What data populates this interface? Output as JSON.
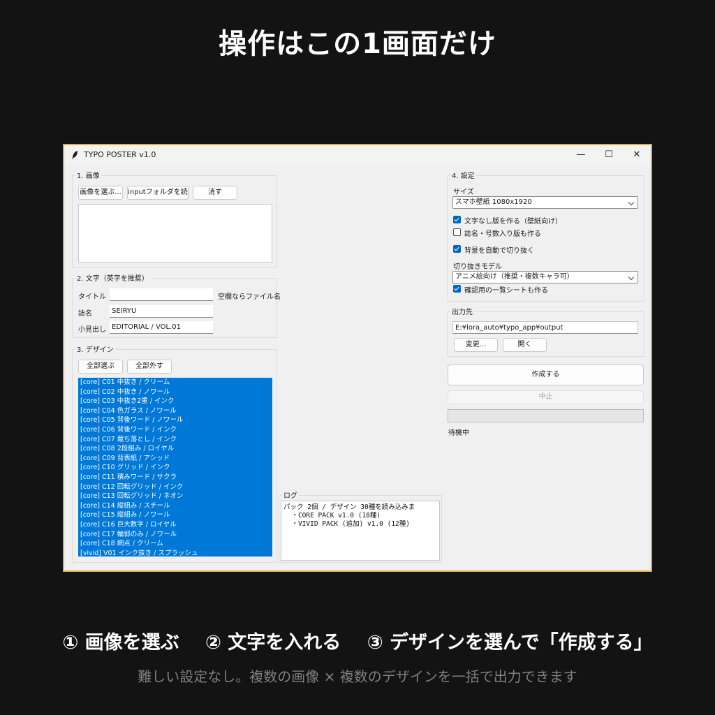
{
  "headline": "操作はこの1画面だけ",
  "window": {
    "title": "TYPO POSTER v1.0",
    "minimize": "—",
    "maximize": "☐",
    "close": "✕"
  },
  "image_group": {
    "label": "1. 画像",
    "choose_button": "画像を選ぶ...",
    "read_folder_button": "inputフォルダを読む",
    "clear_button": "消す"
  },
  "text_group": {
    "label": "2. 文字（英字を推奨）",
    "title_label": "タイトル",
    "title_value": "",
    "title_hint": "空欄ならファイル名",
    "magazine_label": "誌名",
    "magazine_value": "SEIRYU",
    "subheading_label": "小見出し",
    "subheading_value": "EDITORIAL  /  VOL.01"
  },
  "design_group": {
    "label": "3. デザイン",
    "select_all_button": "全部選ぶ",
    "deselect_all_button": "全部外す",
    "items": [
      "[core] C01  中抜き / クリーム",
      "[core] C02  中抜き / ノワール",
      "[core] C03  中抜き2重 / インク",
      "[core] C04  色ガラス / ノワール",
      "[core] C05  背後ワード / ノワール",
      "[core] C06  背後ワード / インク",
      "[core] C07  裁ち落とし / インク",
      "[core] C08  2段組み / ロイヤル",
      "[core] C09  背表紙 / アシッド",
      "[core] C10  グリッド / インク",
      "[core] C11  積みワード / サクラ",
      "[core] C12  回転グリッド / インク",
      "[core] C13  回転グリッド / ネオン",
      "[core] C14  縦組み / スチール",
      "[core] C15  縦組み / ノワール",
      "[core] C16  巨大数字 / ロイヤル",
      "[core] C17  輪郭のみ / ノワール",
      "[core] C18  網点 / クリーム",
      "[vivid] V01  インク抜き / スプラッシュ"
    ]
  },
  "log_group": {
    "label": "ログ",
    "lines": [
      "パック 2個 / デザイン 30種を読み込みま",
      "  ・CORE PACK v1.0 (18種)",
      "  ・VIVID PACK (追加) v1.0 (12種)"
    ]
  },
  "settings_group": {
    "label": "4. 設定",
    "size_label": "サイズ",
    "size_value": "スマホ壁紙 1080x1920",
    "option_no_text": "文字なし版を作る（壁紙向け）",
    "option_no_text_checked": true,
    "option_numbered": "誌名・号数入り版も作る",
    "option_numbered_checked": false,
    "option_auto_cutout": "背景を自動で切り抜く",
    "option_auto_cutout_checked": true,
    "cutout_model_label": "切り抜きモデル",
    "cutout_model_value": "アニメ絵向け（推奨・複数キャラ可）",
    "option_contact_sheet": "確認用の一覧シートも作る",
    "option_contact_sheet_checked": true
  },
  "output_group": {
    "label": "出力先",
    "path": "E:¥lora_auto¥typo_app¥output",
    "change_button": "変更...",
    "open_button": "開く"
  },
  "actions": {
    "create_button": "作成する",
    "stop_button": "中止",
    "progress": 0,
    "status": "待機中"
  },
  "footer": {
    "step1": "① 画像を選ぶ",
    "step2": "② 文字を入れる",
    "step3": "③ デザインを選んで「作成する」",
    "subline": "難しい設定なし。複数の画像 × 複数のデザインを一括で出力できます"
  },
  "colors": {
    "page_bg": "#131313",
    "frame": "#d9b04c",
    "selection": "#0078d7",
    "checkbox": "#0067c0"
  }
}
